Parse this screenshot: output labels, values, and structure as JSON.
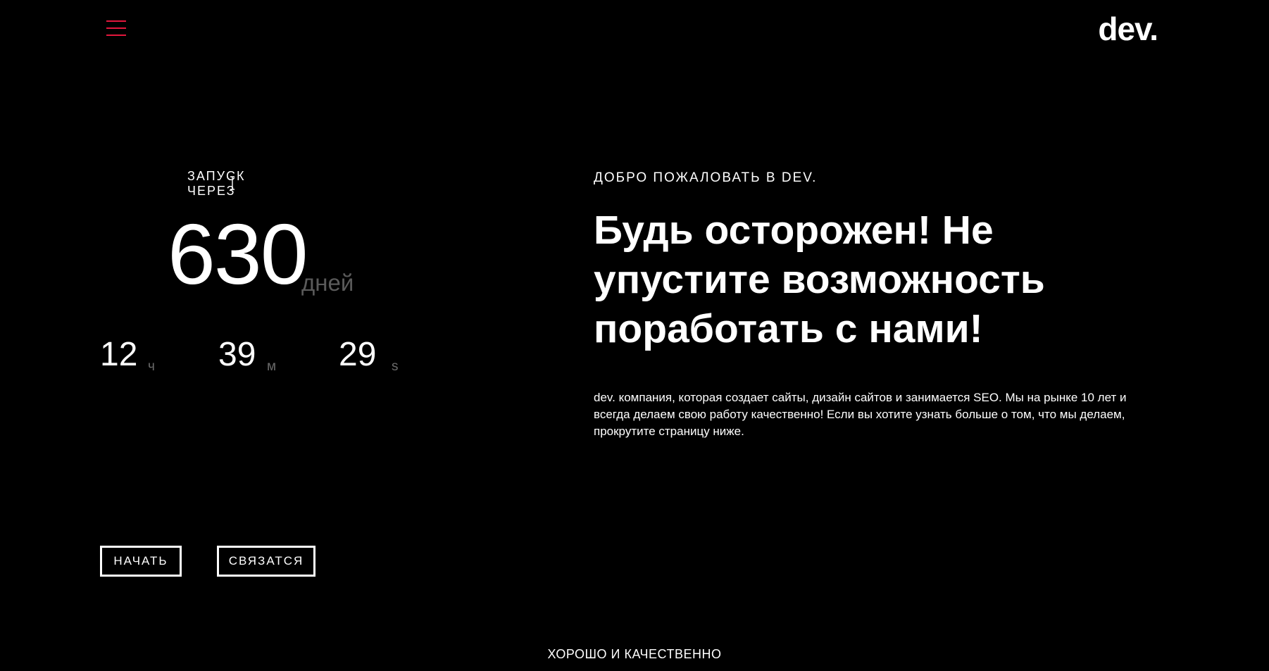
{
  "header": {
    "logo": "dev.",
    "menu_icon": "hamburger-menu-icon",
    "menu_color": "#e3173d"
  },
  "countdown": {
    "label": "ЗАПУСК ЧЕРЕЗ",
    "days": "630",
    "days_unit": "дней",
    "hours": "12",
    "hours_unit": "ч",
    "minutes": "39",
    "minutes_unit": "м",
    "seconds": "29",
    "seconds_unit": "s"
  },
  "actions": {
    "start_label": "НАЧАТЬ",
    "contact_label": "СВЯЗАТСЯ"
  },
  "hero": {
    "welcome": "ДОБРО ПОЖАЛОВАТЬ В DEV.",
    "headline": "Будь осторожен! Не упустите возможность поработать с нами!",
    "description": "dev. компания, которая создает сайты, дизайн сайтов и занимается SEO. Мы на рынке 10 лет и всегда делаем свою работу качественно! Если вы хотите узнать больше о том, что мы делаем, прокрутите страницу ниже."
  },
  "footer": {
    "tagline": "ХОРОШО И КАЧЕСТВЕННО"
  }
}
